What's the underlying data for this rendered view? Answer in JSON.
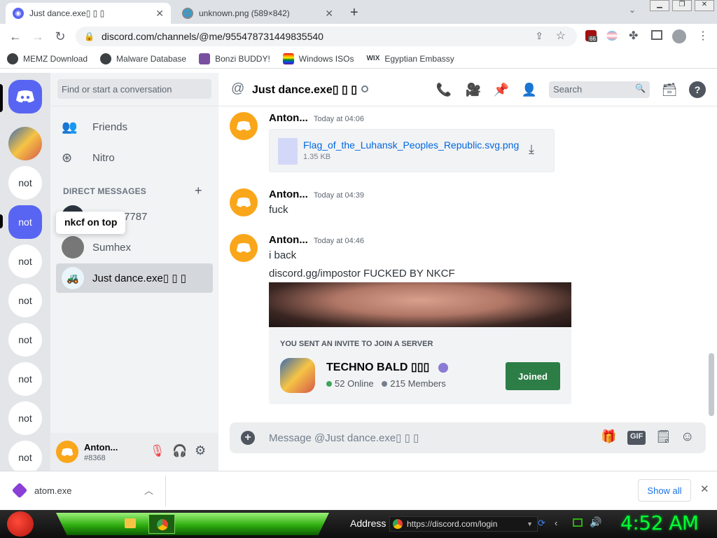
{
  "tabs": [
    {
      "title": "Just dance.exe▯ ▯ ▯"
    },
    {
      "title": "unknown.png (589×842)"
    }
  ],
  "url": "discord.com/channels/@me/955478731449835540",
  "ext_badge": "66",
  "bookmarks": [
    "MEMZ Download",
    "Malware Database",
    "Bonzi BUDDY!",
    "Windows ISOs",
    "Egyptian Embassy"
  ],
  "sidebar": {
    "server_label": "not",
    "tooltip": "nkcf on top"
  },
  "dm": {
    "search_placeholder": "Find or start a conversation",
    "friends": "Friends",
    "nitro": "Nitro",
    "direct_messages_heading": "DIRECT MESSAGES",
    "items": [
      "wofr667787",
      "Sumhex",
      "Just dance.exe▯ ▯ ▯"
    ]
  },
  "user": {
    "name": "Anton...",
    "tag": "#8368"
  },
  "channel": {
    "title": "Just dance.exe▯ ▯ ▯",
    "search_placeholder": "Search"
  },
  "messages": [
    {
      "author": "Anton...",
      "time": "Today at 04:06",
      "file": {
        "name": "Flag_of_the_Luhansk_Peoples_Republic.svg.png",
        "size": "1.35 KB"
      }
    },
    {
      "author": "Anton...",
      "time": "Today at 04:39",
      "lines": [
        "fuck"
      ]
    },
    {
      "author": "Anton...",
      "time": "Today at 04:46",
      "lines": [
        "i back",
        "discord.gg/impostor FUCKED BY NKCF"
      ]
    }
  ],
  "invite": {
    "heading": "YOU SENT AN INVITE TO JOIN A SERVER",
    "server": "TECHNO BALD ▯▯▯",
    "online": "52 Online",
    "members": "215 Members",
    "button": "Joined"
  },
  "composer": {
    "placeholder": "Message @Just dance.exe▯ ▯ ▯",
    "gif": "GIF"
  },
  "download": {
    "file": "atom.exe",
    "show_all": "Show all"
  },
  "taskbar": {
    "address_label": "Address",
    "address_url": "https://discord.com/login",
    "clock": "4:52 AM"
  },
  "colors": {
    "discord_blurple": "#5865f2",
    "joined_green": "#2d7d46",
    "clock_green": "#00ff33"
  }
}
